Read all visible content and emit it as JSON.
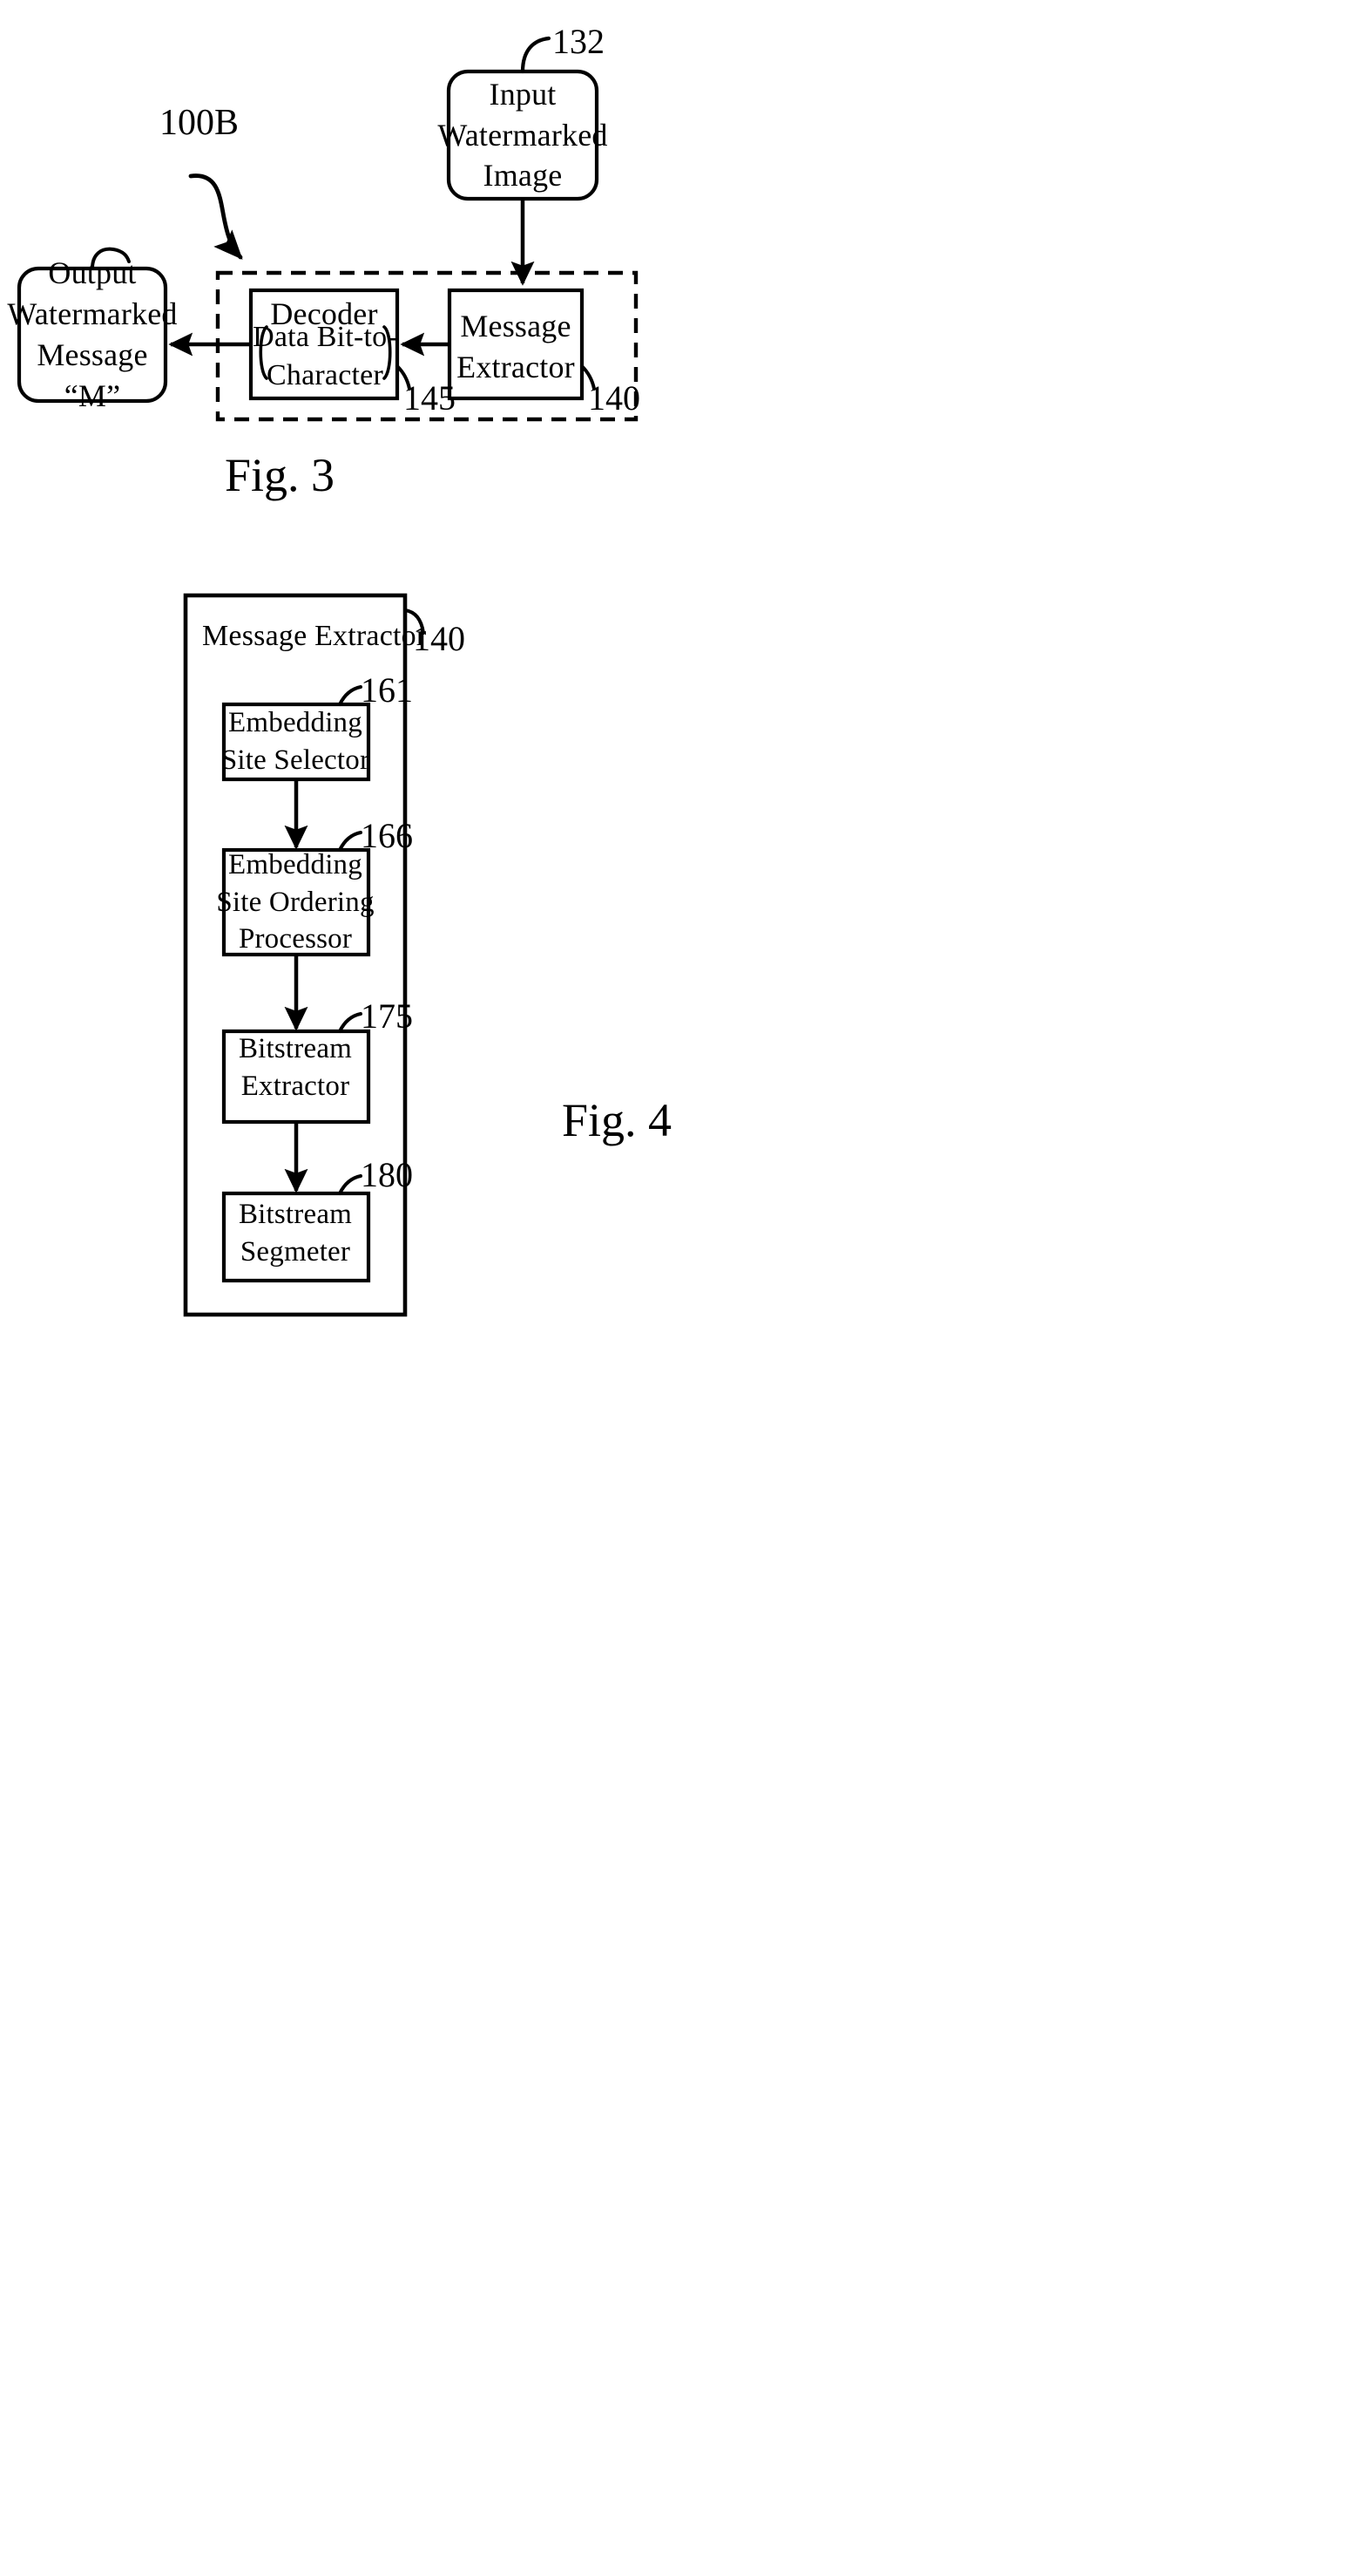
{
  "document": {
    "type": "patent-drawing-sheet",
    "background_color": "#ffffff",
    "line_color": "#000000"
  },
  "figures": [
    {
      "caption": "Fig. 3",
      "system_id": "100B",
      "nodes": [
        {
          "id": "132",
          "label_lines": [
            "Input",
            "Watermarked",
            "Image"
          ],
          "shape": "rounded-rect"
        },
        {
          "id": "140",
          "label_lines": [
            "Message",
            "Extractor"
          ],
          "shape": "rect"
        },
        {
          "id": "145",
          "label_lines": [
            "Decoder",
            "Data Bit-to-",
            "Character"
          ],
          "shape": "rect-with-braces"
        },
        {
          "id": "out",
          "label_lines": [
            "Output",
            "Watermarked",
            "Message",
            "“M”"
          ],
          "shape": "rounded-rect"
        }
      ],
      "edges": [
        {
          "from": "132",
          "to": "140",
          "direction": "down"
        },
        {
          "from": "140",
          "to": "145",
          "direction": "left"
        },
        {
          "from": "145",
          "to": "out",
          "direction": "left"
        }
      ],
      "grouping_box": {
        "style": "dashed",
        "contains": [
          "145",
          "140"
        ]
      }
    },
    {
      "caption": "Fig. 4",
      "container": {
        "id": "140",
        "label": "Message Extractor",
        "shape": "rect"
      },
      "nodes": [
        {
          "id": "161",
          "label_lines": [
            "Embedding",
            "Site Selector"
          ],
          "shape": "rect"
        },
        {
          "id": "166",
          "label_lines": [
            "Embedding",
            "Site Ordering",
            "Processor"
          ],
          "shape": "rect"
        },
        {
          "id": "175",
          "label_lines": [
            "Bitstream",
            "Extractor"
          ],
          "shape": "rect"
        },
        {
          "id": "180",
          "label_lines": [
            "Bitstream",
            "Segmeter"
          ],
          "shape": "rect"
        }
      ],
      "edges": [
        {
          "from": "161",
          "to": "166",
          "direction": "down"
        },
        {
          "from": "166",
          "to": "175",
          "direction": "down"
        },
        {
          "from": "175",
          "to": "180",
          "direction": "down"
        }
      ]
    }
  ],
  "fig3": {
    "caption": "Fig. 3",
    "system_id": "100B",
    "input_box": {
      "line1": "Input",
      "line2": "Watermarked",
      "line3": "Image",
      "ref": "132"
    },
    "message_extractor": {
      "line1": "Message",
      "line2": "Extractor",
      "ref": "140"
    },
    "decoder": {
      "title": "Decoder",
      "line1": "Data Bit-to-",
      "line2": "Character",
      "ref": "145"
    },
    "output_box": {
      "line1": "Output",
      "line2": "Watermarked",
      "line3": "Message",
      "line4": "“M”"
    }
  },
  "fig4": {
    "caption": "Fig. 4",
    "outer": {
      "title": "Message Extractor",
      "ref": "140"
    },
    "blocks": [
      {
        "line1": "Embedding",
        "line2": "Site Selector",
        "line3": "",
        "ref": "161"
      },
      {
        "line1": "Embedding",
        "line2": "Site Ordering",
        "line3": "Processor",
        "ref": "166"
      },
      {
        "line1": "Bitstream",
        "line2": "Extractor",
        "line3": "",
        "ref": "175"
      },
      {
        "line1": "Bitstream",
        "line2": "Segmeter",
        "line3": "",
        "ref": "180"
      }
    ]
  }
}
